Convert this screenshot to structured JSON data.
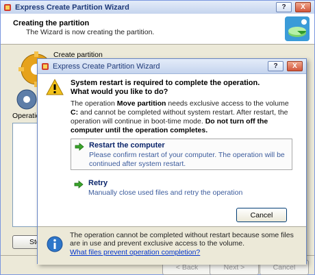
{
  "background_window": {
    "title": "Express Create Partition Wizard",
    "controls": {
      "help": "?",
      "close": "X"
    },
    "header": {
      "title": "Creating the partition",
      "subtitle": "The Wizard is now creating the partition."
    },
    "body": {
      "create_label": "Create partition",
      "operations_label": "Operatio",
      "stop_button": "Sto"
    },
    "footer": {
      "back": "< Back",
      "next": "Next >",
      "cancel": "Cancel"
    }
  },
  "dialog": {
    "title": "Express Create Partition Wizard",
    "controls": {
      "help": "?",
      "close": "X"
    },
    "heading_line1": "System restart is required to complete the operation.",
    "heading_line2": "What would you like to do?",
    "body": {
      "p1": "The operation ",
      "op_name": "Move partition",
      "p2": " needs exclusive access to the volume ",
      "volume": "C:",
      "p3": " and cannot be completed without system restart. After restart, the operation will continue in boot-time mode. ",
      "warning": "Do not turn off the computer until the operation completes."
    },
    "options": [
      {
        "title": "Restart the computer",
        "description": "Please confirm restart of your computer. The operation will be continued after system restart."
      },
      {
        "title": "Retry",
        "description": "Manually close used files and retry the operation"
      }
    ],
    "cancel_button": "Cancel",
    "info": {
      "text": "The operation cannot be completed without restart because some files are in use and prevent exclusive access to the volume.",
      "link": "What files prevent operation completion?"
    }
  },
  "colors": {
    "title_bar": "#c5d4ee",
    "link": "#0033cc",
    "option_desc": "#3b5b9c",
    "arrow": "#3aa42b",
    "warning": "#f2c21b",
    "info": "#2e76c9"
  }
}
